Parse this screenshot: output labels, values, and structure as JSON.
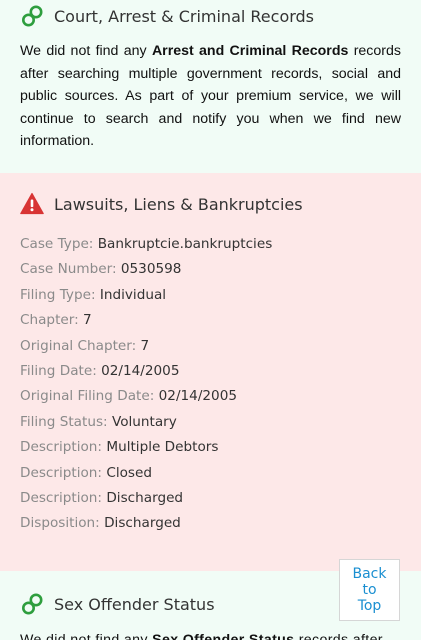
{
  "sections": {
    "court": {
      "title": "Court, Arrest & Criminal Records",
      "icon": "linked-rings-icon",
      "body": {
        "p1": "We did not find any ",
        "bold": "Arrest and Criminal Records",
        "p2": " records after searching multiple government records, social and public sources. As part of your premium service, we will continue to search and notify you when we find new information."
      }
    },
    "lawsuits": {
      "title": "Lawsuits, Liens & Bankruptcies",
      "icon": "warning-icon",
      "rows": [
        {
          "key": "Case Type:",
          "value": "Bankruptcie.bankruptcies"
        },
        {
          "key": "Case Number:",
          "value": "0530598"
        },
        {
          "key": "Filing Type:",
          "value": "Individual"
        },
        {
          "key": "Chapter:",
          "value": "7"
        },
        {
          "key": "Original Chapter:",
          "value": "7"
        },
        {
          "key": "Filing Date:",
          "value": "02/14/2005"
        },
        {
          "key": "Original Filing Date:",
          "value": "02/14/2005"
        },
        {
          "key": "Filing Status:",
          "value": "Voluntary"
        },
        {
          "key": "Description:",
          "value": "Multiple Debtors"
        },
        {
          "key": "Description:",
          "value": "Closed"
        },
        {
          "key": "Description:",
          "value": "Discharged"
        },
        {
          "key": "Disposition:",
          "value": "Discharged"
        }
      ]
    },
    "sex_offender": {
      "title": "Sex Offender Status",
      "icon": "linked-rings-icon",
      "body": {
        "p1": "We did not find any ",
        "bold": "Sex Offender Status",
        "p2": " records after"
      }
    }
  },
  "back_to_top": {
    "line1": "Back",
    "line2": "to",
    "line3": "Top"
  },
  "colors": {
    "green_icon": "#2e9e3e",
    "warning_red": "#d83434",
    "link_blue": "#1a8fd1",
    "green_bg": "#f1fcf6",
    "red_bg": "#fde8e8"
  }
}
